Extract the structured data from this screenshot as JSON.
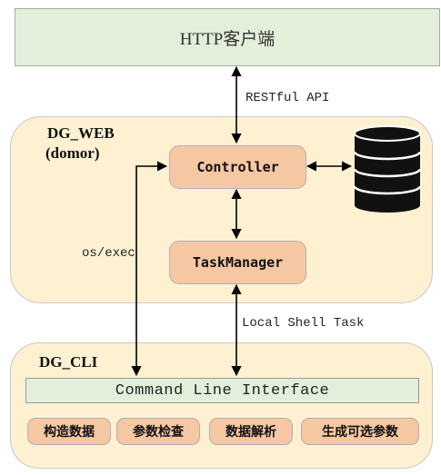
{
  "client": {
    "title": "HTTP客户端"
  },
  "web": {
    "title_line1": "DG_WEB",
    "title_line2": "(domor)"
  },
  "nodes": {
    "controller": "Controller",
    "task_manager": "TaskManager"
  },
  "edges": {
    "restful_api": "RESTful API",
    "os_exec": "os/exec",
    "local_shell_task": "Local Shell Task"
  },
  "cli": {
    "title": "DG_CLI",
    "interface": "Command Line Interface",
    "functions": [
      "构造数据",
      "参数检查",
      "数据解析",
      "生成可选参数"
    ]
  },
  "icons": {
    "database": "database-icon"
  },
  "colors": {
    "client_fill": "#e2efda",
    "group_fill": "#fdf1d2",
    "node_fill": "#f6c7a3",
    "database": "#111111"
  }
}
